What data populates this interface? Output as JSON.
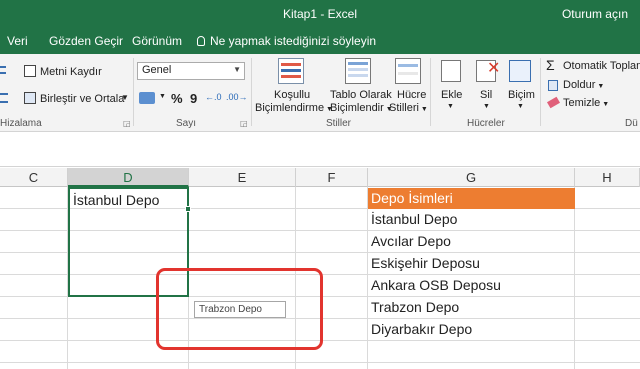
{
  "window": {
    "title": "Kitap1  -  Excel",
    "signin": "Oturum açın"
  },
  "tabs": [
    "Veri",
    "Gözden Geçir",
    "Görünüm"
  ],
  "tellme": "Ne yapmak istediğinizi söyleyin",
  "ribbon": {
    "alignment": {
      "wrap_text": "Metni Kaydır",
      "merge_center": "Birleştir ve Ortala",
      "group_label": "Hizalama"
    },
    "number": {
      "format": "Genel",
      "percent": "%",
      "comma": "9",
      "group_label": "Sayı"
    },
    "styles": {
      "conditional_1": "Koşullu",
      "conditional_2": "Biçimlendirme",
      "table_1": "Tablo Olarak",
      "table_2": "Biçimlendir",
      "cell_styles_1": "Hücre",
      "cell_styles_2": "Stilleri",
      "group_label": "Stiller"
    },
    "cells": {
      "insert": "Ekle",
      "delete": "Sil",
      "format": "Biçim",
      "group_label": "Hücreler"
    },
    "editing": {
      "autosum": "Otomatik Toplam",
      "fill": "Doldur",
      "clear": "Temizle",
      "group_label": "Dü"
    }
  },
  "columns": [
    "C",
    "D",
    "E",
    "F",
    "G",
    "H"
  ],
  "selected_column": "D",
  "cells": {
    "d1": "İstanbul Depo",
    "g_header": "Depo İsimleri",
    "g_items": [
      "İstanbul Depo",
      "Avcılar Depo",
      "Eskişehir Deposu",
      "Ankara OSB Deposu",
      "Trabzon Depo",
      "Diyarbakır Depo"
    ]
  },
  "autocomplete_tooltip": "Trabzon Depo",
  "colors": {
    "excel_green": "#217346",
    "header_orange": "#ed7d31",
    "highlight_red": "#e2342e"
  }
}
